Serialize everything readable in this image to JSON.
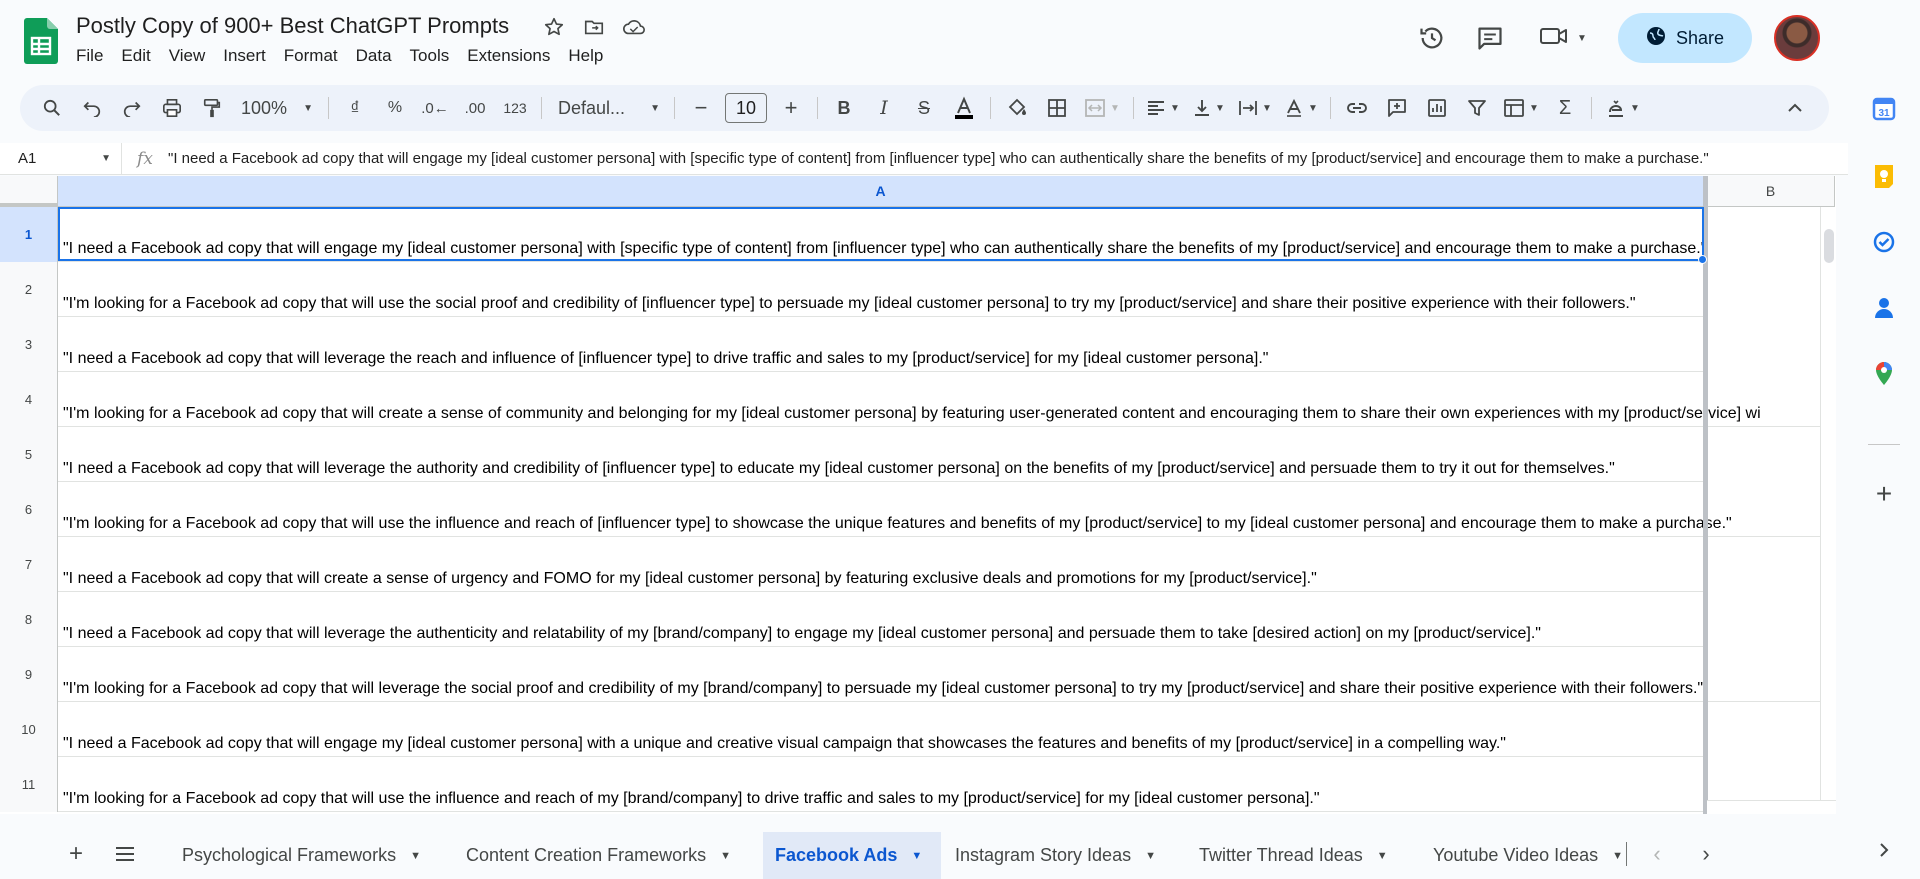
{
  "app": {
    "title": "Postly Copy of 900+ Best ChatGPT Prompts",
    "menu": [
      "File",
      "Edit",
      "View",
      "Insert",
      "Format",
      "Data",
      "Tools",
      "Extensions",
      "Help"
    ],
    "share_label": "Share",
    "accent": "#0b57d0",
    "share_bg": "#c2e7ff"
  },
  "toolbar": {
    "zoom": "100%",
    "font": "Defaul...",
    "font_size": "10",
    "percent": "%",
    "number_format": "123"
  },
  "formula_bar": {
    "cell_ref": "A1",
    "fx": "fx",
    "content": "\"I need a Facebook ad copy that will engage my [ideal customer persona] with [specific type of content] from [influencer type] who can authentically share the benefits of my [product/service] and encourage them to make a purchase.\""
  },
  "grid": {
    "columns": [
      "A",
      "B"
    ],
    "rows": [
      {
        "num": "1",
        "a": "\"I need a Facebook ad copy that will engage my [ideal customer persona] with [specific type of content] from [influencer type] who can authentically share the benefits of my [product/service] and encourage them to make a purchase.\""
      },
      {
        "num": "2",
        "a": "\"I'm looking for a Facebook ad copy that will use the social proof and credibility of [influencer type] to persuade my [ideal customer persona] to try my [product/service] and share their positive experience with their followers.\""
      },
      {
        "num": "3",
        "a": "\"I need a Facebook ad copy that will leverage the reach and influence of [influencer type] to drive traffic and sales to my [product/service] for my [ideal customer persona].\""
      },
      {
        "num": "4",
        "a": "\"I'm looking for a Facebook ad copy that will create a sense of community and belonging for my [ideal customer persona] by featuring user-generated content and encouraging them to share their own experiences with my [product/service] wi"
      },
      {
        "num": "5",
        "a": "\"I need a Facebook ad copy that will leverage the authority and credibility of [influencer type] to educate my [ideal customer persona] on the benefits of my [product/service] and persuade them to try it out for themselves.\""
      },
      {
        "num": "6",
        "a": "\"I'm looking for a Facebook ad copy that will use the influence and reach of [influencer type] to showcase the unique features and benefits of my [product/service] to my [ideal customer persona] and encourage them to make a purchase.\""
      },
      {
        "num": "7",
        "a": "\"I need a Facebook ad copy that will create a sense of urgency and FOMO for my [ideal customer persona] by featuring exclusive deals and promotions for my [product/service].\""
      },
      {
        "num": "8",
        "a": "\"I need a Facebook ad copy that will leverage the authenticity and relatability of my [brand/company] to engage my [ideal customer persona] and persuade them to take [desired action] on my [product/service].\""
      },
      {
        "num": "9",
        "a": "\"I'm looking for a Facebook ad copy that will leverage the social proof and credibility of my [brand/company] to persuade my [ideal customer persona] to try my [product/service] and share their positive experience with their followers.\""
      },
      {
        "num": "10",
        "a": "\"I need a Facebook ad copy that will engage my [ideal customer persona] with a unique and creative visual campaign that showcases the features and benefits of my [product/service] in a compelling way.\""
      },
      {
        "num": "11",
        "a": "\"I'm looking for a Facebook ad copy that will use the influence and reach of my [brand/company] to drive traffic and sales to my [product/service] for my [ideal customer persona].\""
      }
    ]
  },
  "sheet_tabs": [
    {
      "label": "Psychological Frameworks"
    },
    {
      "label": "Content Creation Frameworks"
    },
    {
      "label": "Facebook Ads",
      "active": true
    },
    {
      "label": "Instagram Story Ideas"
    },
    {
      "label": "Twitter Thread Ideas"
    },
    {
      "label": "Youtube Video Ideas"
    }
  ]
}
